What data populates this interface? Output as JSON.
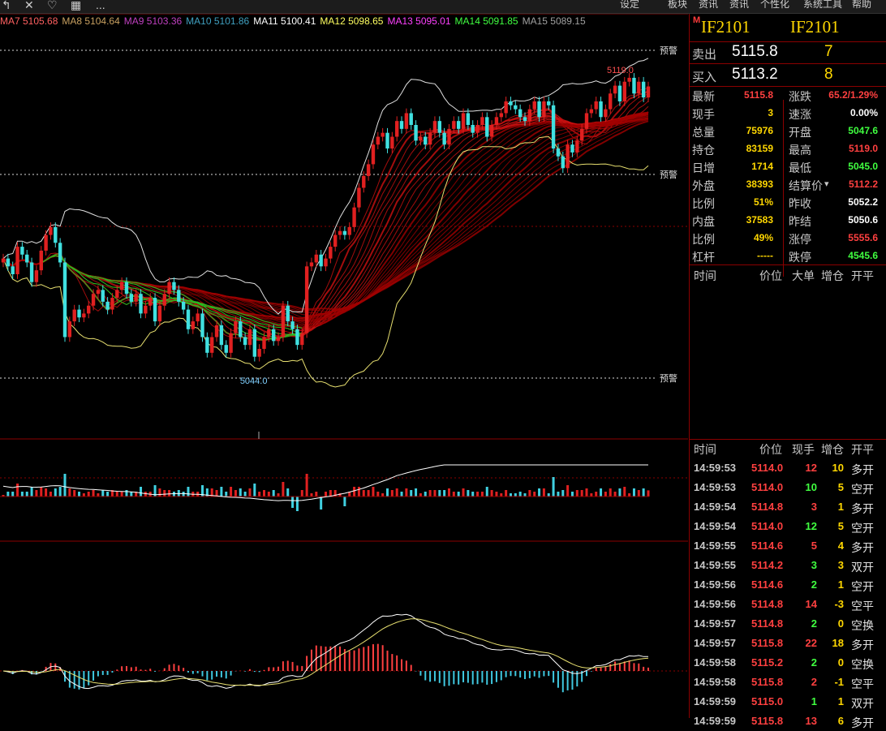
{
  "toolbar": {
    "icons": [
      "back-arrow-icon",
      "close-x-icon",
      "heart-icon",
      "calculator-icon",
      "more-dots-icon"
    ],
    "more": "...",
    "menu": [
      "设定",
      "板块",
      "资讯",
      "资讯",
      "个性化",
      "系统工具",
      "帮助"
    ]
  },
  "ma_indicators": [
    {
      "label": "MA7",
      "value": "5105.68",
      "color": "#ff6060"
    },
    {
      "label": "MA8",
      "value": "5104.64",
      "color": "#c8a060"
    },
    {
      "label": "MA9",
      "value": "5103.36",
      "color": "#c040c0"
    },
    {
      "label": "MA10",
      "value": "5101.86",
      "color": "#40a0c0"
    },
    {
      "label": "MA11",
      "value": "5100.41",
      "color": "#ffffff"
    },
    {
      "label": "MA12",
      "value": "5098.65",
      "color": "#ffff60"
    },
    {
      "label": "MA13",
      "value": "5095.01",
      "color": "#ff40ff"
    },
    {
      "label": "MA14",
      "value": "5091.85",
      "color": "#40ff40"
    },
    {
      "label": "MA15",
      "value": "5089.15",
      "color": "#a0a0a0"
    }
  ],
  "chart_labels": {
    "low_marker": "5044.0",
    "high_marker": "5119.0",
    "warn1": "预警",
    "warn2": "预警",
    "warn3": "预警"
  },
  "header": {
    "m": "M",
    "code1": "IF2101",
    "code2": "IF2101"
  },
  "order_book": {
    "sell_label": "卖出",
    "sell_price": "5115.8",
    "sell_vol": "7",
    "buy_label": "买入",
    "buy_price": "5113.2",
    "buy_vol": "8"
  },
  "quote": [
    {
      "l1": "最新",
      "v1": "5115.8",
      "c1": "#ff4040",
      "l2": "涨跌",
      "v2": "65.2/1.29%",
      "c2": "#ff4040"
    },
    {
      "l1": "现手",
      "v1": "3",
      "c1": "#ffd700",
      "l2": "速涨",
      "v2": "0.00%",
      "c2": "#ffffff"
    },
    {
      "l1": "总量",
      "v1": "75976",
      "c1": "#ffd700",
      "l2": "开盘",
      "v2": "5047.6",
      "c2": "#40ff40"
    },
    {
      "l1": "持仓",
      "v1": "83159",
      "c1": "#ffd700",
      "l2": "最高",
      "v2": "5119.0",
      "c2": "#ff4040"
    },
    {
      "l1": "日增",
      "v1": "1714",
      "c1": "#ffd700",
      "l2": "最低",
      "v2": "5045.0",
      "c2": "#40ff40"
    },
    {
      "l1": "外盘",
      "v1": "38393",
      "c1": "#ffd700",
      "l2": "结算价",
      "v2": "5112.2",
      "c2": "#ff4040"
    },
    {
      "l1": "比例",
      "v1": "51%",
      "c1": "#ffd700",
      "l2": "昨收",
      "v2": "5052.2",
      "c2": "#ffffff"
    },
    {
      "l1": "内盘",
      "v1": "37583",
      "c1": "#ffd700",
      "l2": "昨结",
      "v2": "5050.6",
      "c2": "#ffffff"
    },
    {
      "l1": "比例",
      "v1": "49%",
      "c1": "#ffd700",
      "l2": "涨停",
      "v2": "5555.6",
      "c2": "#ff4040"
    },
    {
      "l1": "杠杆",
      "v1": "-----",
      "c1": "#ffd700",
      "l2": "跌停",
      "v2": "4545.6",
      "c2": "#40ff40"
    }
  ],
  "big_order_header": {
    "time": "时间",
    "price": "价位",
    "big": "大单",
    "chg": "增仓",
    "open": "开平"
  },
  "trade_header": {
    "time": "时间",
    "price": "价位",
    "hand": "现手",
    "chg": "增仓",
    "open": "开平"
  },
  "trades": [
    {
      "t": "14:59:53",
      "p": "5114.0",
      "h": "12",
      "hc": "#ff4040",
      "z": "10",
      "zc": "#ffd700",
      "k": "多开"
    },
    {
      "t": "14:59:53",
      "p": "5114.0",
      "h": "10",
      "hc": "#40ff40",
      "z": "5",
      "zc": "#ffd700",
      "k": "空开"
    },
    {
      "t": "14:59:54",
      "p": "5114.8",
      "h": "3",
      "hc": "#ff4040",
      "z": "1",
      "zc": "#ffd700",
      "k": "多开"
    },
    {
      "t": "14:59:54",
      "p": "5114.0",
      "h": "12",
      "hc": "#40ff40",
      "z": "5",
      "zc": "#ffd700",
      "k": "空开"
    },
    {
      "t": "14:59:55",
      "p": "5114.6",
      "h": "5",
      "hc": "#ff4040",
      "z": "4",
      "zc": "#ffd700",
      "k": "多开"
    },
    {
      "t": "14:59:55",
      "p": "5114.2",
      "h": "3",
      "hc": "#40ff40",
      "z": "3",
      "zc": "#ffd700",
      "k": "双开"
    },
    {
      "t": "14:59:56",
      "p": "5114.6",
      "h": "2",
      "hc": "#40ff40",
      "z": "1",
      "zc": "#ffd700",
      "k": "空开"
    },
    {
      "t": "14:59:56",
      "p": "5114.8",
      "h": "14",
      "hc": "#ff4040",
      "z": "-3",
      "zc": "#ffd700",
      "k": "空平"
    },
    {
      "t": "14:59:57",
      "p": "5114.8",
      "h": "2",
      "hc": "#40ff40",
      "z": "0",
      "zc": "#ffd700",
      "k": "空换"
    },
    {
      "t": "14:59:57",
      "p": "5115.8",
      "h": "22",
      "hc": "#ff4040",
      "z": "18",
      "zc": "#ffd700",
      "k": "多开"
    },
    {
      "t": "14:59:58",
      "p": "5115.2",
      "h": "2",
      "hc": "#40ff40",
      "z": "0",
      "zc": "#ffd700",
      "k": "空换"
    },
    {
      "t": "14:59:58",
      "p": "5115.8",
      "h": "2",
      "hc": "#ff4040",
      "z": "-1",
      "zc": "#ffd700",
      "k": "空平"
    },
    {
      "t": "14:59:59",
      "p": "5115.0",
      "h": "1",
      "hc": "#40ff40",
      "z": "1",
      "zc": "#ffd700",
      "k": "双开"
    },
    {
      "t": "14:59:59",
      "p": "5115.8",
      "h": "13",
      "hc": "#ff4040",
      "z": "6",
      "zc": "#ffd700",
      "k": "多开"
    }
  ],
  "chart_data": {
    "type": "candlestick",
    "symbol": "IF2101",
    "price_range": [
      5030,
      5125
    ],
    "low": 5044.0,
    "high": 5119.0,
    "closes": [
      5072,
      5070,
      5068,
      5075,
      5073,
      5071,
      5066,
      5069,
      5074,
      5078,
      5080,
      5076,
      5071,
      5052,
      5056,
      5059,
      5057,
      5058,
      5060,
      5063,
      5064,
      5061,
      5059,
      5062,
      5064,
      5066,
      5063,
      5061,
      5063,
      5058,
      5060,
      5062,
      5056,
      5060,
      5063,
      5066,
      5064,
      5061,
      5059,
      5054,
      5056,
      5058,
      5052,
      5048,
      5052,
      5055,
      5050,
      5048,
      5053,
      5056,
      5052,
      5050,
      5054,
      5047,
      5049,
      5052,
      5054,
      5051,
      5052,
      5060,
      5056,
      5054,
      5050,
      5053,
      5070,
      5071,
      5073,
      5070,
      5072,
      5075,
      5078,
      5079,
      5078,
      5080,
      5085,
      5090,
      5093,
      5096,
      5101,
      5103,
      5104,
      5100,
      5103,
      5107,
      5105,
      5109,
      5106,
      5102,
      5103,
      5101,
      5104,
      5107,
      5104,
      5101,
      5105,
      5107,
      5105,
      5109,
      5106,
      5104,
      5106,
      5108,
      5103,
      5106,
      5108,
      5109,
      5112,
      5111,
      5110,
      5108,
      5107,
      5110,
      5112,
      5108,
      5112,
      5111,
      5100,
      5098,
      5095,
      5101,
      5099,
      5102,
      5105,
      5109,
      5110,
      5112,
      5108,
      5110,
      5114,
      5116,
      5112,
      5117,
      5118,
      5114,
      5117,
      5113,
      5115.8
    ]
  }
}
